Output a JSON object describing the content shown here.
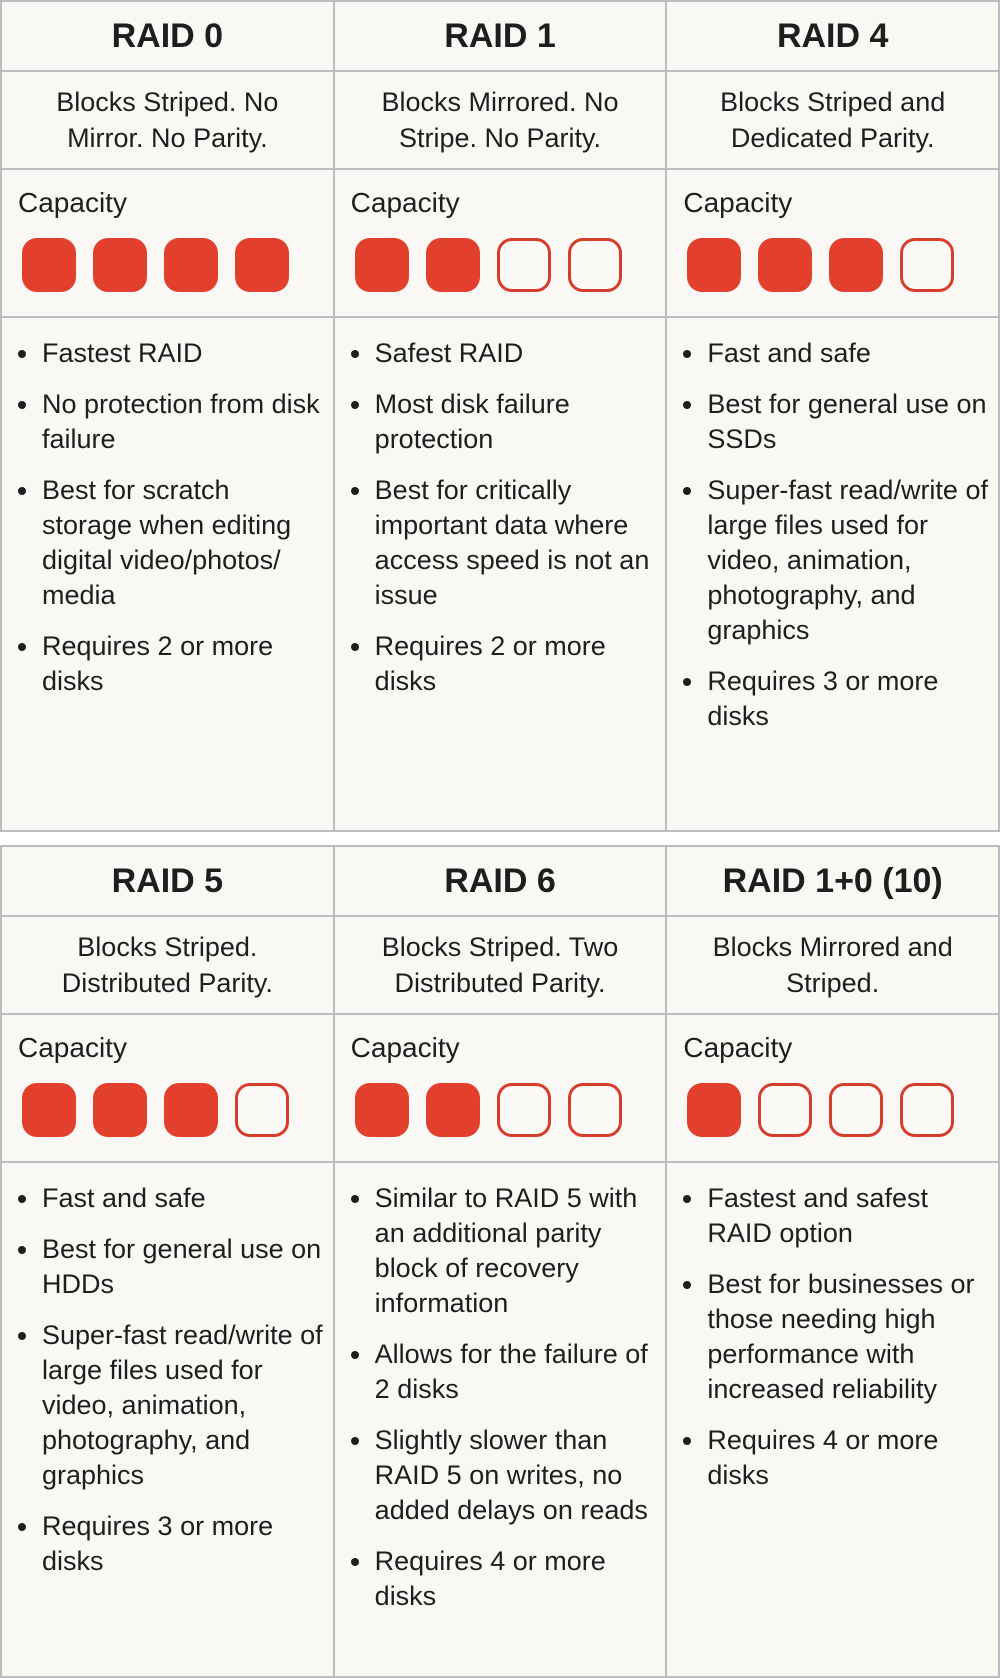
{
  "colors": {
    "accent": "#e2402d",
    "background": "#f9f8f4",
    "border": "#bcbcc1"
  },
  "capacity_label": "Capacity",
  "levels": [
    {
      "title": "RAID 0",
      "description": "Blocks Striped. No Mirror. No Parity.",
      "capacity_filled": 4,
      "capacity_total": 4,
      "bullets": [
        "Fastest RAID",
        "No protection from disk failure",
        "Best for scratch storage when editing digital video/photos/ media",
        "Requires 2 or more disks"
      ]
    },
    {
      "title": "RAID 1",
      "description": "Blocks Mirrored. No Stripe. No Parity.",
      "capacity_filled": 2,
      "capacity_total": 4,
      "bullets": [
        "Safest RAID",
        "Most disk failure protection",
        "Best for critically important data where access speed is not an issue",
        "Requires 2 or more disks"
      ]
    },
    {
      "title": "RAID 4",
      "description": "Blocks Striped and Dedicated Parity.",
      "capacity_filled": 3,
      "capacity_total": 4,
      "bullets": [
        "Fast and safe",
        "Best for general use on SSDs",
        "Super-fast read/write of large files used for video, animation, photography, and graphics",
        "Requires 3 or more disks"
      ]
    },
    {
      "title": "RAID 5",
      "description": "Blocks Striped. Distributed Parity.",
      "capacity_filled": 3,
      "capacity_total": 4,
      "bullets": [
        "Fast and safe",
        "Best for general use on HDDs",
        "Super-fast read/write of large files used for video, animation, photography, and graphics",
        "Requires 3 or more disks"
      ]
    },
    {
      "title": "RAID 6",
      "description": "Blocks Striped. Two Distributed Parity.",
      "capacity_filled": 2,
      "capacity_total": 4,
      "bullets": [
        "Similar to RAID 5 with an additional parity block of recovery information",
        "Allows for the failure of 2 disks",
        "Slightly slower than RAID 5 on writes, no added delays on reads",
        "Requires 4 or more disks"
      ]
    },
    {
      "title": "RAID 1+0 (10)",
      "description": "Blocks Mirrored and Striped.",
      "capacity_filled": 1,
      "capacity_total": 4,
      "bullets": [
        "Fastest and safest RAID option",
        "Best for businesses or those needing high performance with increased reliability",
        "Requires 4 or more disks"
      ]
    }
  ]
}
